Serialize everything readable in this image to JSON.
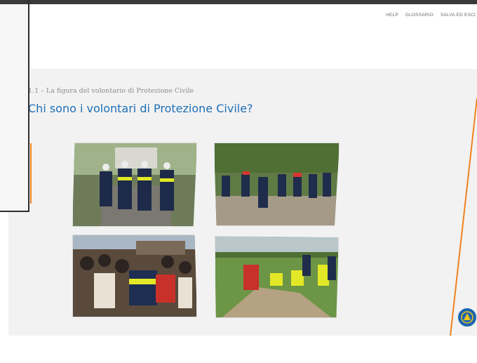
{
  "nav": {
    "items": [
      "HELP",
      "GLOSSARIO",
      "SALVA ED ESCI"
    ]
  },
  "content": {
    "breadcrumb": "1.1 – La figura del volontario di Protezione Civile",
    "title": "Chi sono i volontari di Protezione Civile?"
  },
  "photos": [
    {
      "subject": "volunteers-walking-street-photo"
    },
    {
      "subject": "volunteers-gathering-field-photo"
    },
    {
      "subject": "volunteers-crowd-aid-photo"
    },
    {
      "subject": "volunteers-sandbag-work-photo"
    }
  ],
  "colors": {
    "title": "#1f6fb6",
    "accent": "#f0831f",
    "stage_bg": "#f2f2f2",
    "logo": "#1c64b0"
  },
  "logo": {
    "icon": "civil-protection-logo-icon"
  }
}
